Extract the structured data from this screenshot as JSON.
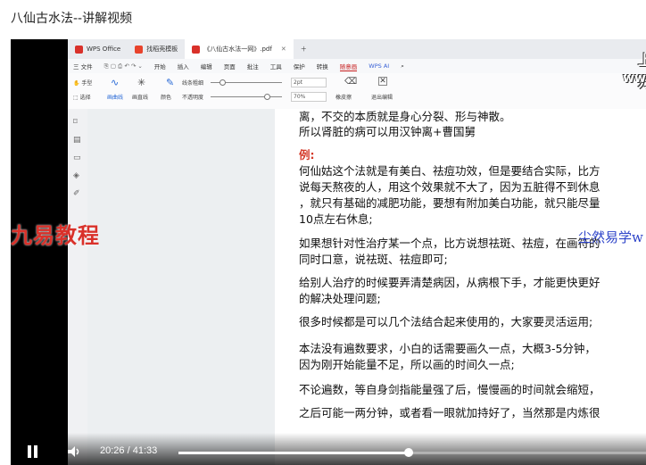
{
  "page_title": "八仙古水法--讲解视频",
  "wps": {
    "tabs": [
      {
        "label": "WPS Office",
        "color": "#d9312a"
      },
      {
        "label": "找稻壳模板",
        "color": "#e8432c"
      },
      {
        "label": "《八仙古水法一网》.pdf",
        "color": "#d9312a"
      }
    ],
    "menu": [
      "三 文件",
      "开始",
      "插入",
      "编辑",
      "页面",
      "批注",
      "工具",
      "保护",
      "转换",
      "随意画",
      "WPS AI"
    ],
    "active_menu": "随意画",
    "ribbon": {
      "tools": [
        "手型",
        "选择",
        "画曲线",
        "画直线",
        "颜色",
        "不透明度",
        "线条粗细",
        "橡皮擦",
        "退出编辑"
      ],
      "thickness_value": "2pt",
      "opacity_value": "70%"
    }
  },
  "document": {
    "lines": [
      "离，不交的本质就是身心分裂、形与神散。",
      "所以肾脏的病可以用汉钟离+曹国舅",
      "例:",
      "何仙姑这个法就是有美白、祛痘功效，但是要结合实际，比方",
      "说每天熬夜的人，用这个效果就不大了，因为五脏得不到休息",
      "，就只有基础的减肥功能，要想有附加美白功能，就只能尽量",
      "10点左右休息;",
      "如果想针对性治疗某一个点，比方说想祛斑、祛痘，在画符的",
      "同时口意，说祛斑、祛痘即可;",
      "给别人治疗的时候要弄清楚病因，从病根下手，才能更快更好",
      "的解决处理问题;",
      "很多时候都是可以几个法结合起来使用的，大家要灵活运用;",
      "本法没有遍数要求，小白的话需要画久一点，大概3-5分钟，",
      "因为刚开始能量不足，所以画的时间久一点;",
      "不论遍数，等自身剑指能量强了后，慢慢画的时间就会缩短，",
      "之后可能一两分钟，或者看一眼就加持好了，当然那是内炼很"
    ]
  },
  "watermarks": {
    "left": "九易教程",
    "top_right": "上万",
    "top_right_2": "www",
    "blue": "尘然易学w"
  },
  "player": {
    "current_time": "20:26",
    "separator": "/",
    "duration": "41:33",
    "progress_fraction": 0.4916,
    "state": "playing"
  }
}
